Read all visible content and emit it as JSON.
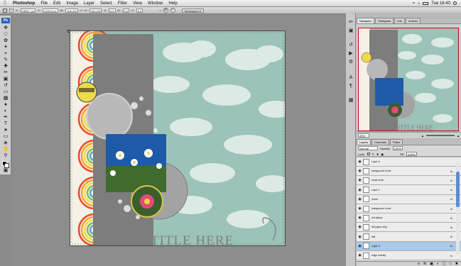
{
  "menubar": {
    "apple": "",
    "app_name": "Photoshop",
    "items": [
      "File",
      "Edit",
      "Image",
      "Layer",
      "Select",
      "Filter",
      "View",
      "Window",
      "Help"
    ],
    "clock": "Tue 16:40",
    "search_icon": "magnifier-icon"
  },
  "options_bar": {
    "x_value": "2358.7 px",
    "y_value": "1499.5 px",
    "w_value": "100.0%",
    "h_value": "100.0%",
    "angle": "0.0",
    "h_skew": "0.0",
    "v_skew": "0.0",
    "workspace_label": "Workspace ▾",
    "cancel": "⊘",
    "commit": "✓"
  },
  "panels": {
    "nav_tabs": [
      "Navigator",
      "Histogram",
      "Info",
      "Actions"
    ],
    "zoom": "25%",
    "layer_tabs": [
      "Layers",
      "Channels",
      "Paths"
    ],
    "blend_mode": "Normal",
    "opacity_label": "Opacity:",
    "opacity_value": "100%",
    "lock_label": "Lock:",
    "fill_label": "Fill:",
    "fill_value": "100%"
  },
  "layers": [
    {
      "name": "Layer 3",
      "fx": false,
      "selected": false
    },
    {
      "name": "background circle",
      "fx": true,
      "selected": false
    },
    {
      "name": "small circle",
      "fx": true,
      "selected": false
    },
    {
      "name": "Layer 1",
      "fx": true,
      "selected": false
    },
    {
      "name": "photo",
      "fx": true,
      "selected": false
    },
    {
      "name": "background circle",
      "fx": true,
      "selected": false
    },
    {
      "name": "dot stamp",
      "fx": true,
      "selected": false
    },
    {
      "name": "tall paper strip",
      "fx": true,
      "selected": false
    },
    {
      "name": "title",
      "fx": true,
      "selected": false
    },
    {
      "name": "Layer 0",
      "fx": true,
      "selected": true
    },
    {
      "name": "edge overlay",
      "fx": true,
      "selected": false
    }
  ],
  "canvas": {
    "title_text": "TITLE HERE",
    "background_color": "#9cc3b8",
    "strip_color": "#7d7d7d"
  },
  "colors": {
    "accent": "#5a8fd2",
    "selection": "#a9c8ea"
  }
}
